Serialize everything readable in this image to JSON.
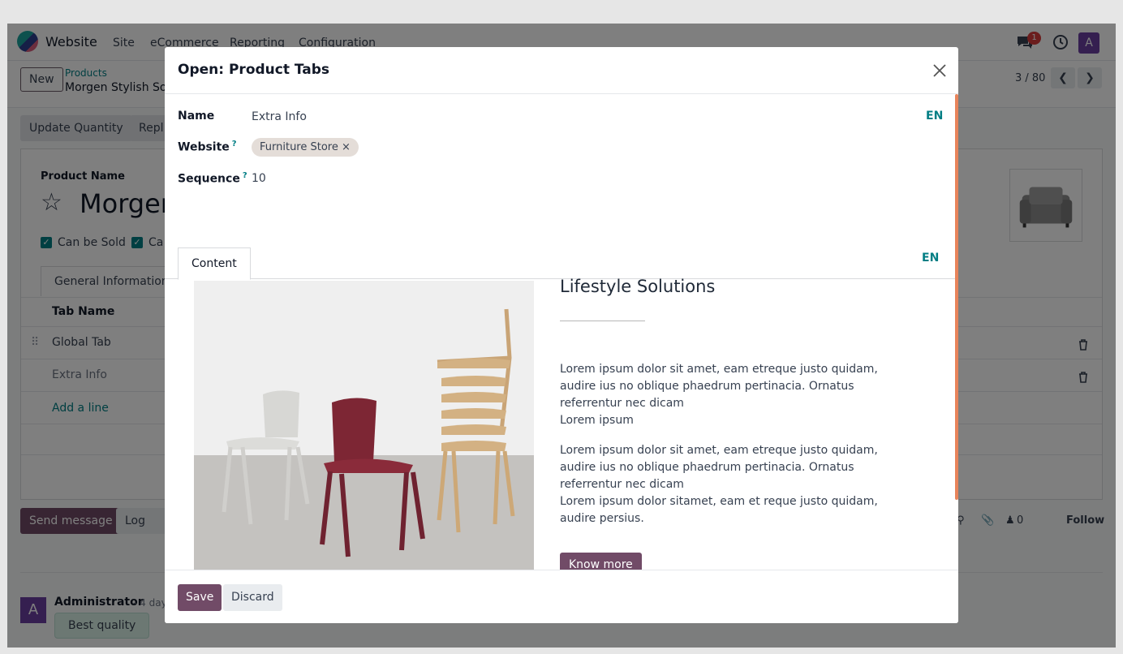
{
  "navbar": {
    "app_name": "Website",
    "menu": [
      "Site",
      "eCommerce",
      "Reporting",
      "Configuration"
    ],
    "message_count": "1",
    "user_initial": "A"
  },
  "control_panel": {
    "new_label": "New",
    "breadcrumb_parent": "Products",
    "breadcrumb_current": "Morgen Stylish Sofa",
    "pager": "3 / 80"
  },
  "action_buttons": [
    "Update Quantity",
    "Repl"
  ],
  "product": {
    "name_label": "Product Name",
    "name": "Morgen",
    "can_be_sold": "Can be Sold",
    "can_be_purchased": "Ca",
    "tab_general": "General Information"
  },
  "tab_table": {
    "header": "Tab Name",
    "rows": [
      "Global Tab",
      "Extra Info"
    ],
    "add_line": "Add a line"
  },
  "chatter": {
    "send_message": "Send message",
    "log_note": "Log not",
    "follower_count": "0",
    "follow": "Follow",
    "author": "Administrator",
    "date": "- 4 day",
    "message": "Best quality",
    "author_initial": "A"
  },
  "dialog": {
    "title": "Open: Product Tabs",
    "fields": {
      "name_label": "Name",
      "name_value": "Extra Info",
      "website_label": "Website",
      "website_tag": "Furniture Store",
      "sequence_label": "Sequence",
      "sequence_value": "10",
      "help_mark": "?",
      "lang": "EN"
    },
    "tab_label": "Content",
    "content": {
      "lang": "EN",
      "heading": "Lifestyle Solutions",
      "para1_line1": "Lorem ipsum dolor sit amet, eam etreque justo quidam, audire ius no oblique phaedrum pertinacia. Ornatus referrentur nec dicam",
      "para1_line2": "Lorem ipsum",
      "para2_line1": "Lorem ipsum dolor sit amet, eam etreque justo quidam, audire ius no oblique phaedrum pertinacia. Ornatus referrentur nec dicam",
      "para2_line2": "Lorem ipsum dolor sitamet, eam et reque justo quidam, audire persius.",
      "button": "Know more"
    },
    "save_label": "Save",
    "discard_label": "Discard"
  },
  "colors": {
    "primary": "#714b67",
    "link": "#017e84",
    "badge": "#d63b3b",
    "scrollbar": "#e8845b"
  }
}
